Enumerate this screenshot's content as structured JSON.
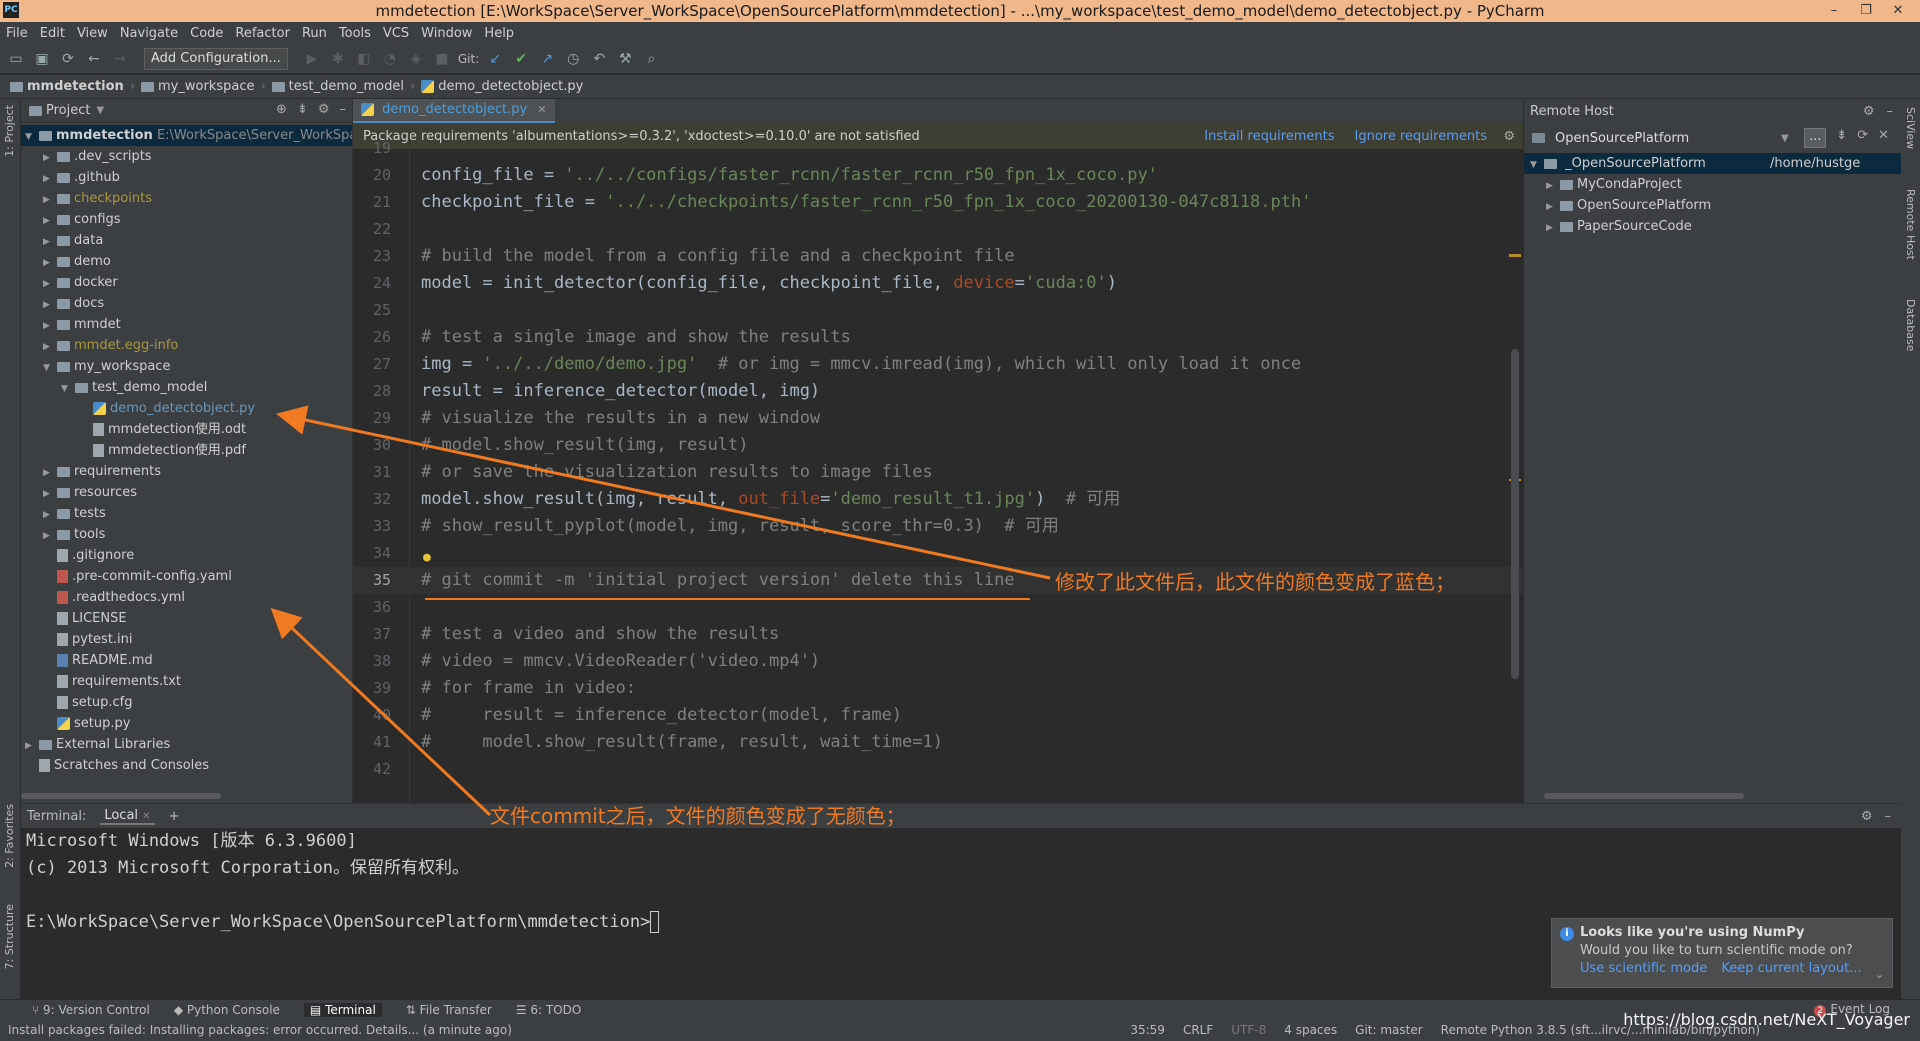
{
  "window": {
    "title": "mmdetection [E:\\WorkSpace\\Server_WorkSpace\\OpenSourcePlatform\\mmdetection] - ...\\my_workspace\\test_demo_model\\demo_detectobject.py - PyCharm",
    "app_icon": "PC",
    "controls": [
      "–",
      "❐",
      "✕"
    ]
  },
  "menu": [
    "File",
    "Edit",
    "View",
    "Navigate",
    "Code",
    "Refactor",
    "Run",
    "Tools",
    "VCS",
    "Window",
    "Help"
  ],
  "toolbar": {
    "add_configuration": "Add Configuration...",
    "git_label": "Git:"
  },
  "breadcrumbs": [
    "mmdetection",
    "my_workspace",
    "test_demo_model",
    "demo_detectobject.py"
  ],
  "project_panel": {
    "title": "Project",
    "root_name": "mmdetection",
    "root_path": "E:\\WorkSpace\\Server_WorkSpace",
    "items": [
      {
        "label": ".dev_scripts",
        "type": "folder",
        "depth": 1,
        "expandable": true
      },
      {
        "label": ".github",
        "type": "folder",
        "depth": 1,
        "expandable": true
      },
      {
        "label": "checkpoints",
        "type": "folder",
        "depth": 1,
        "expandable": true,
        "status": "ignored"
      },
      {
        "label": "configs",
        "type": "folder",
        "depth": 1,
        "expandable": true
      },
      {
        "label": "data",
        "type": "folder",
        "depth": 1,
        "expandable": true
      },
      {
        "label": "demo",
        "type": "folder",
        "depth": 1,
        "expandable": true
      },
      {
        "label": "docker",
        "type": "folder",
        "depth": 1,
        "expandable": true
      },
      {
        "label": "docs",
        "type": "folder",
        "depth": 1,
        "expandable": true
      },
      {
        "label": "mmdet",
        "type": "folder",
        "depth": 1,
        "expandable": true
      },
      {
        "label": "mmdet.egg-info",
        "type": "folder",
        "depth": 1,
        "expandable": true,
        "status": "ignored"
      },
      {
        "label": "my_workspace",
        "type": "folder",
        "depth": 1,
        "expandable": true,
        "expanded": true
      },
      {
        "label": "test_demo_model",
        "type": "folder",
        "depth": 2,
        "expandable": true,
        "expanded": true
      },
      {
        "label": "demo_detectobject.py",
        "type": "py",
        "depth": 3,
        "status": "modified"
      },
      {
        "label": "mmdetection使用.odt",
        "type": "file",
        "depth": 3
      },
      {
        "label": "mmdetection使用.pdf",
        "type": "file",
        "depth": 3
      },
      {
        "label": "requirements",
        "type": "folder",
        "depth": 1,
        "expandable": true
      },
      {
        "label": "resources",
        "type": "folder",
        "depth": 1,
        "expandable": true
      },
      {
        "label": "tests",
        "type": "folder",
        "depth": 1,
        "expandable": true
      },
      {
        "label": "tools",
        "type": "folder",
        "depth": 1,
        "expandable": true
      },
      {
        "label": ".gitignore",
        "type": "file",
        "depth": 1
      },
      {
        "label": ".pre-commit-config.yaml",
        "type": "file-red",
        "depth": 1
      },
      {
        "label": ".readthedocs.yml",
        "type": "file-red",
        "depth": 1
      },
      {
        "label": "LICENSE",
        "type": "file",
        "depth": 1
      },
      {
        "label": "pytest.ini",
        "type": "file",
        "depth": 1
      },
      {
        "label": "README.md",
        "type": "file-md",
        "depth": 1
      },
      {
        "label": "requirements.txt",
        "type": "file",
        "depth": 1
      },
      {
        "label": "setup.cfg",
        "type": "file",
        "depth": 1
      },
      {
        "label": "setup.py",
        "type": "py",
        "depth": 1
      },
      {
        "label": "External Libraries",
        "type": "lib",
        "depth": 0,
        "expandable": true
      },
      {
        "label": "Scratches and Consoles",
        "type": "scratch",
        "depth": 0
      }
    ]
  },
  "editor": {
    "tab_label": "demo_detectobject.py",
    "notice_text": "Package requirements 'albumentations>=0.3.2', 'xdoctest>=0.10.0' are not satisfied",
    "notice_install": "Install requirements",
    "notice_ignore": "Ignore requirements",
    "lines": [
      {
        "n": "19",
        "parts": []
      },
      {
        "n": "20",
        "parts": [
          [
            "c",
            "config_file = "
          ],
          [
            "s",
            "'../../configs/faster_rcnn/faster_rcnn_r50_fpn_1x_coco.py'"
          ]
        ]
      },
      {
        "n": "21",
        "parts": [
          [
            "c",
            "checkpoint_file = "
          ],
          [
            "s",
            "'../../checkpoints/faster_rcnn_r50_fpn_1x_coco_20200130-047c8118.pth'"
          ]
        ]
      },
      {
        "n": "22",
        "parts": []
      },
      {
        "n": "23",
        "parts": [
          [
            "m",
            "# build the model from a config file and a checkpoint file"
          ]
        ]
      },
      {
        "n": "24",
        "parts": [
          [
            "c",
            "model = init_detector(config_file, checkpoint_file, "
          ],
          [
            "k",
            "device"
          ],
          [
            "c",
            "="
          ],
          [
            "s",
            "'cuda:0'"
          ],
          [
            "c",
            ")"
          ]
        ]
      },
      {
        "n": "25",
        "parts": []
      },
      {
        "n": "26",
        "parts": [
          [
            "m",
            "# test a single image and show the results"
          ]
        ]
      },
      {
        "n": "27",
        "parts": [
          [
            "c",
            "img = "
          ],
          [
            "s",
            "'../../demo/demo.jpg'"
          ],
          [
            "m",
            "  # or img = mmcv.imread(img), which will only load it once"
          ]
        ]
      },
      {
        "n": "28",
        "parts": [
          [
            "c",
            "result = inference_detector(model, img)"
          ]
        ]
      },
      {
        "n": "29",
        "parts": [
          [
            "m",
            "# visualize the results in a new window"
          ]
        ]
      },
      {
        "n": "30",
        "parts": [
          [
            "m",
            "# model.show_result(img, result)"
          ]
        ]
      },
      {
        "n": "31",
        "parts": [
          [
            "m",
            "# or save the visualization results to image files"
          ]
        ]
      },
      {
        "n": "32",
        "parts": [
          [
            "c",
            "model.show_result(img, result, "
          ],
          [
            "k",
            "out_file"
          ],
          [
            "c",
            "="
          ],
          [
            "s",
            "'demo_result_t1.jpg'"
          ],
          [
            "c",
            ")  "
          ],
          [
            "m",
            "# 可用"
          ]
        ]
      },
      {
        "n": "33",
        "parts": [
          [
            "m",
            "# show_result_pyplot(model, img, result, score_thr=0.3)  # 可用"
          ]
        ]
      },
      {
        "n": "34",
        "parts": [],
        "bulb": true
      },
      {
        "n": "35",
        "parts": [
          [
            "m",
            "# git commit -m 'initial project version' delete this line"
          ]
        ],
        "current": true
      },
      {
        "n": "36",
        "parts": []
      },
      {
        "n": "37",
        "parts": [
          [
            "m",
            "# test a video and show the results"
          ]
        ]
      },
      {
        "n": "38",
        "parts": [
          [
            "m",
            "# video = mmcv.VideoReader('video.mp4')"
          ]
        ]
      },
      {
        "n": "39",
        "parts": [
          [
            "m",
            "# for frame in video:"
          ]
        ]
      },
      {
        "n": "40",
        "parts": [
          [
            "m",
            "#     result = inference_detector(model, frame)"
          ]
        ]
      },
      {
        "n": "41",
        "parts": [
          [
            "m",
            "#     model.show_result(frame, result, wait_time=1)"
          ]
        ]
      },
      {
        "n": "42",
        "parts": []
      }
    ]
  },
  "remote_host": {
    "title": "Remote Host",
    "selected_server": "OpenSourcePlatform",
    "more_label": "...",
    "root_label": "_OpenSourcePlatform",
    "root_path": "/home/hustge",
    "items": [
      "MyCondaProject",
      "OpenSourcePlatform",
      "PaperSourceCode"
    ]
  },
  "side_labels": {
    "left_top": "1: Project",
    "left_mid": "2: Favorites",
    "left_bottom": "7: Structure",
    "right_1": "SciView",
    "right_2": "Remote Host",
    "right_3": "Database"
  },
  "terminal": {
    "label": "Terminal:",
    "tab": "Local",
    "lines": [
      "Microsoft Windows [版本 6.3.9600]",
      "(c) 2013 Microsoft Corporation。保留所有权利。",
      "",
      "E:\\WorkSpace\\Server_WorkSpace\\OpenSourcePlatform\\mmdetection>"
    ]
  },
  "notification": {
    "title": "Looks like you're using NumPy",
    "body": "Would you like to turn scientific mode on?",
    "action_1": "Use scientific mode",
    "action_2": "Keep current layout..."
  },
  "bottom_tools": {
    "items": [
      "9: Version Control",
      "Python Console",
      "Terminal",
      "File Transfer",
      "6: TODO"
    ],
    "active": "Terminal",
    "event_log": "Event Log",
    "event_count": "2"
  },
  "status": {
    "message": "Install packages failed: Installing packages: error occurred. Details... (a minute ago)",
    "position": "35:59",
    "line_sep": "CRLF",
    "encoding": "UTF-8",
    "indent": "4 spaces",
    "git": "Git: master",
    "interpreter": "Remote Python 3.8.5 (sft...ilrvc/...minilab/bin/python)"
  },
  "annotations": {
    "modified_note": "修改了此文件后，此文件的颜色变成了蓝色；",
    "commit_note": "文件commit之后，文件的颜色变成了无颜色；",
    "watermark": "https://blog.csdn.net/NeXT_Voyager",
    "color": "#f07a22"
  }
}
